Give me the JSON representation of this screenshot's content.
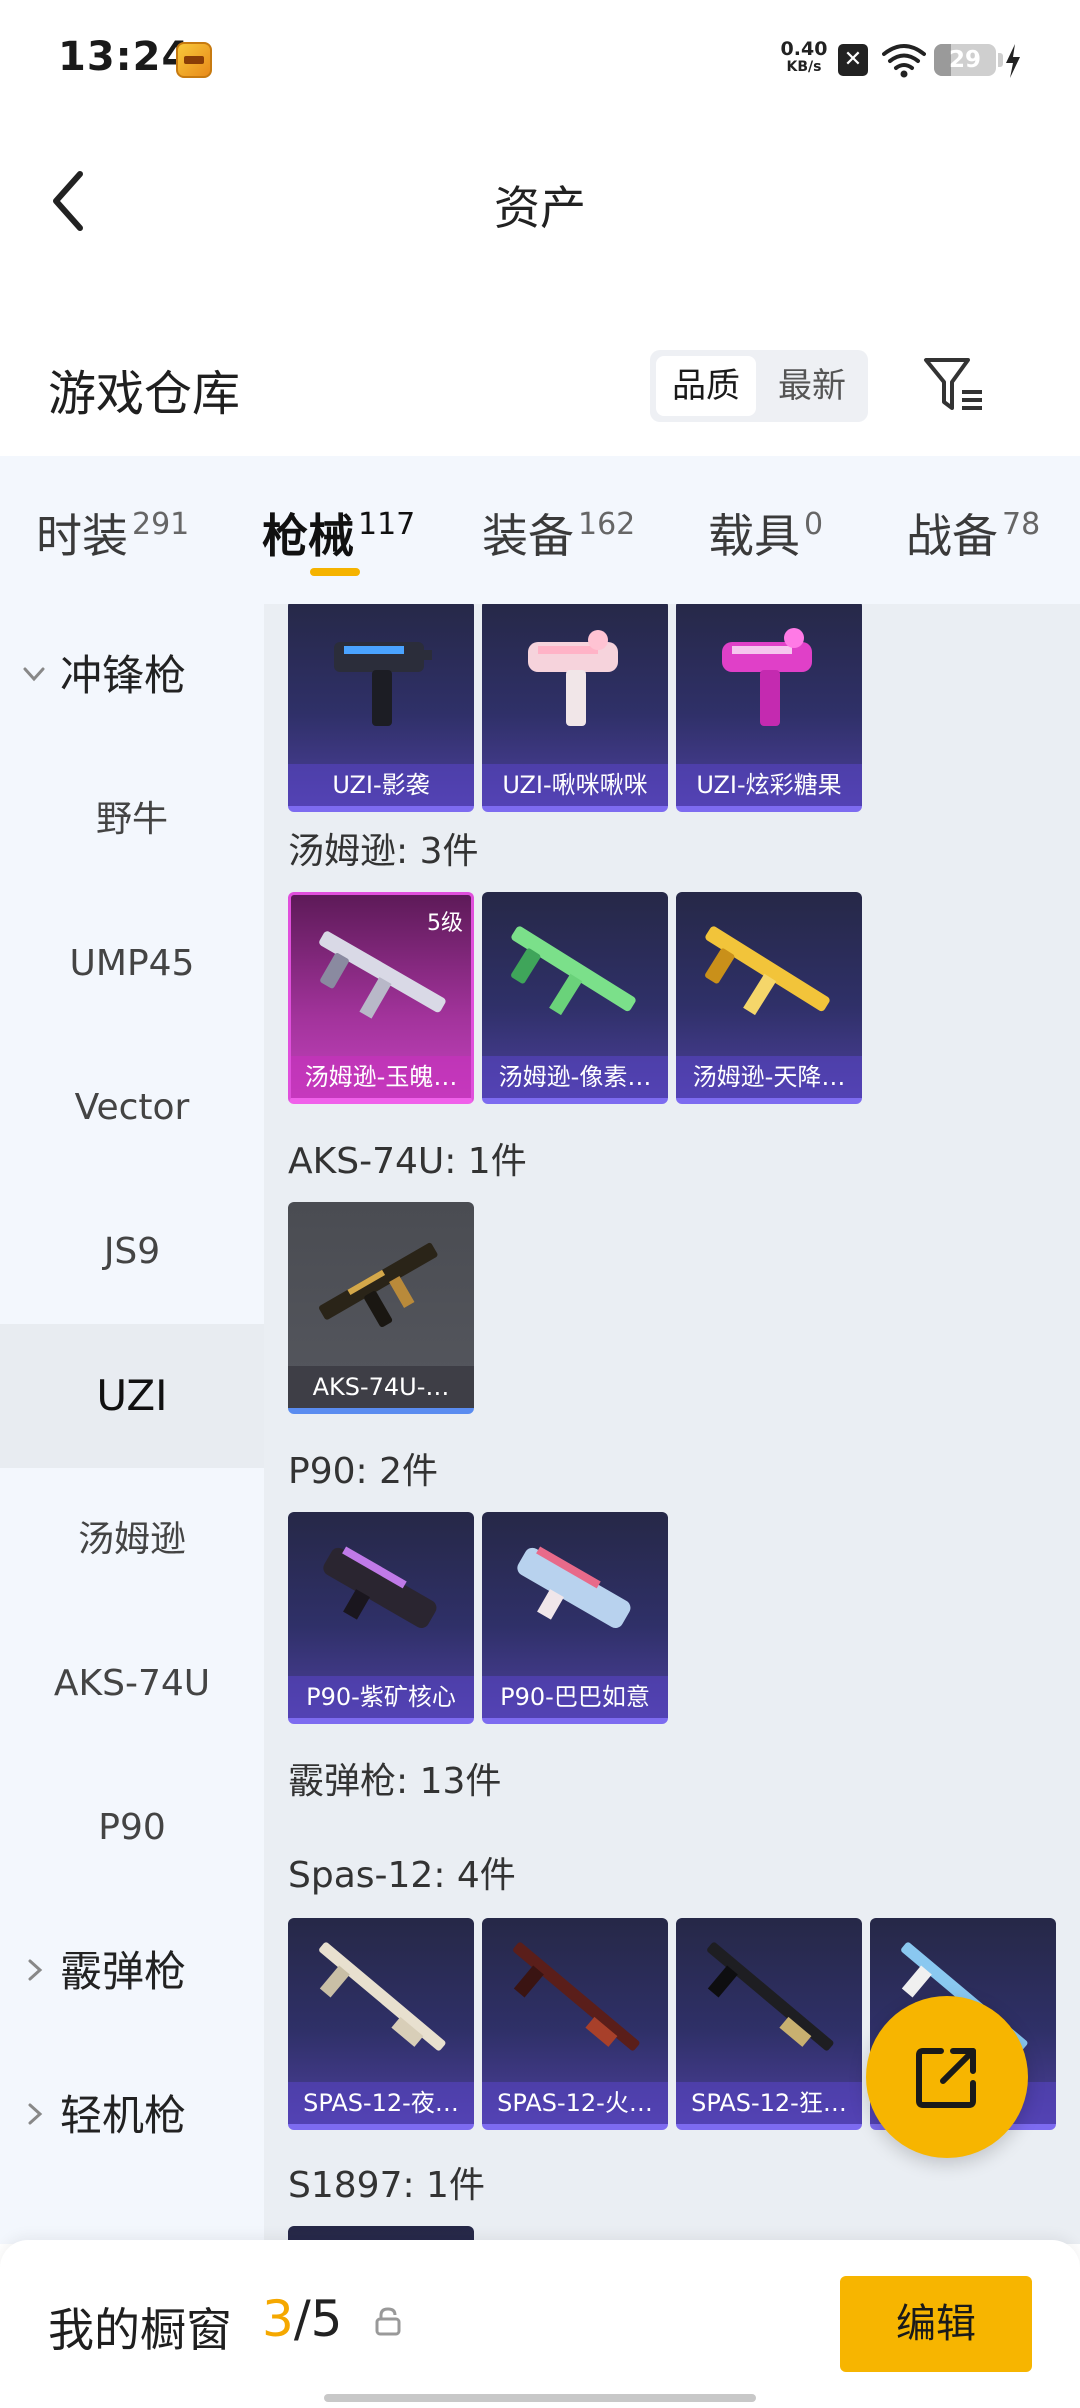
{
  "status_bar": {
    "time": "13:24",
    "net_speed": "0.40",
    "net_unit": "KB/s",
    "battery": "29",
    "icons": [
      "game-app-icon",
      "close-x-icon",
      "wifi-icon",
      "battery-icon",
      "charging-bolt-icon"
    ]
  },
  "nav": {
    "title": "资产",
    "back_icon": "back-arrow-icon"
  },
  "header": {
    "title": "游戏仓库",
    "sort_options": [
      "品质",
      "最新"
    ],
    "sort_selected": "品质",
    "filter_icon": "filter-icon"
  },
  "tabs": [
    {
      "label": "时装",
      "count": "291"
    },
    {
      "label": "枪械",
      "count": "117",
      "active": true
    },
    {
      "label": "装备",
      "count": "162"
    },
    {
      "label": "载具",
      "count": "0"
    },
    {
      "label": "战备",
      "count": "78"
    }
  ],
  "sidebar": {
    "category_smg": "冲锋枪",
    "items": [
      "野牛",
      "UMP45",
      "Vector",
      "JS9",
      "UZI",
      "汤姆逊",
      "AKS-74U",
      "P90"
    ],
    "selected": "UZI",
    "category_shotgun": "霰弹枪",
    "category_lmg": "轻机枪"
  },
  "main": {
    "uzi_cards": [
      "UZI-影袭",
      "UZI-啾咪啾咪",
      "UZI-炫彩糖果"
    ],
    "thompson_header": "汤姆逊: 3件",
    "thompson_cards": [
      {
        "name": "汤姆逊-玉魄…",
        "level": "5级"
      },
      {
        "name": "汤姆逊-像素…"
      },
      {
        "name": "汤姆逊-天降…"
      }
    ],
    "aks_header": "AKS-74U: 1件",
    "aks_cards": [
      "AKS-74U-…"
    ],
    "p90_header": "P90: 2件",
    "p90_cards": [
      "P90-紫矿核心",
      "P90-巴巴如意"
    ],
    "shotgun_header": "霰弹枪: 13件",
    "spas_header": "Spas-12: 4件",
    "spas_cards": [
      "SPAS-12-夜…",
      "SPAS-12-火…",
      "SPAS-12-狂…",
      "…"
    ],
    "s1897_header": "S1897: 1件"
  },
  "fab": {
    "icon": "share-export-icon"
  },
  "bottom": {
    "label": "我的橱窗",
    "current": "3",
    "separator": "/",
    "total": "5",
    "lock_icon": "lock-icon",
    "edit_label": "编辑"
  },
  "colors": {
    "accent": "#f7b500",
    "sidebar_bg": "#f3f7fd",
    "content_bg": "#eaeef3",
    "card_purple": "#2f3068",
    "card_pink": "#c342bd"
  }
}
